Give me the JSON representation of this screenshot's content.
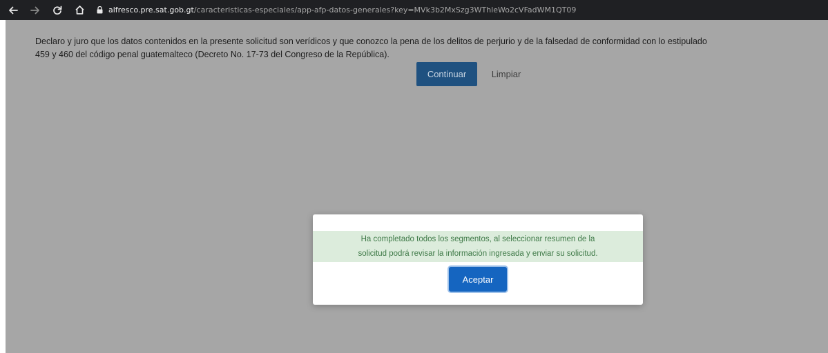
{
  "browser": {
    "url_host": "alfresco.pre.sat.gob.gt",
    "url_path": "/caracteristicas-especiales/app-afp-datos-generales?key=MVk3b2MxSzg3WThleWo2cVFadWM1QT09"
  },
  "declaration": {
    "line1": "Declaro y juro que los datos contenidos en la presente solicitud son verídicos y que conozco la pena de los delitos de perjurio y de la falsedad de conformidad con lo estipulado",
    "line2": "459 y 460 del código penal guatemalteco (Decreto No. 17-73 del Congreso de la República)."
  },
  "actions": {
    "continuar_label": "Continuar",
    "limpiar_label": "Limpiar"
  },
  "modal": {
    "message_line1": "Ha completado todos los segmentos, al seleccionar resumen de la",
    "message_line2": "solicitud podrá revisar la información ingresada y enviar su solicitud.",
    "accept_label": "Aceptar"
  },
  "icons": {
    "back": "arrow-left-icon",
    "forward": "arrow-right-icon",
    "reload": "reload-icon",
    "home": "home-icon",
    "lock": "lock-icon"
  },
  "colors": {
    "primary_button": "#1f5180",
    "accept_button": "#1565c0",
    "alert_background": "#dcecdc",
    "alert_text": "#3f7a48",
    "overlay": "#a6a6a6"
  }
}
